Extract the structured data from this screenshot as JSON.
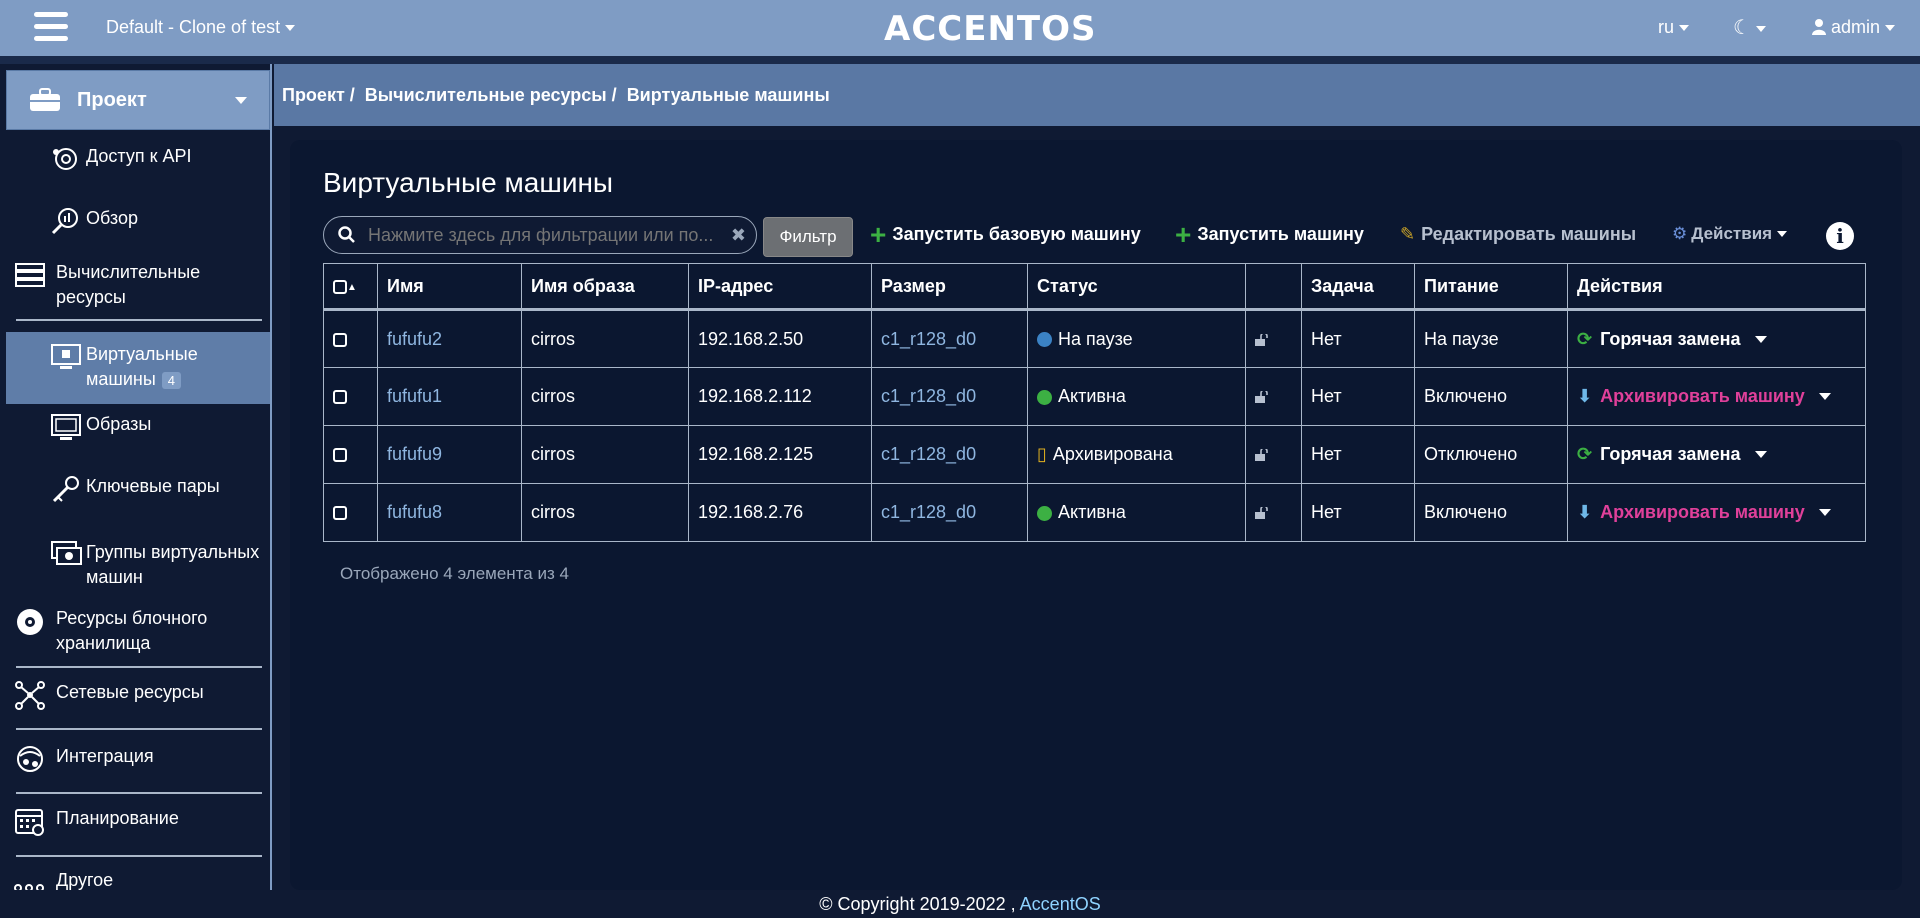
{
  "header": {
    "project_switch": "Default - Clone of test",
    "logo": "ACCENTOS",
    "lang": "ru",
    "user": "admin"
  },
  "sidebar": {
    "project_label": "Проект",
    "items": [
      {
        "label": "Доступ к API",
        "icon": "api-access-icon"
      },
      {
        "label": "Обзор",
        "icon": "overview-icon"
      },
      {
        "label": "Вычислительные ресурсы",
        "icon": "compute-icon"
      },
      {
        "label": "Виртуальные машины",
        "badge": "4",
        "icon": "vm-icon"
      },
      {
        "label": "Образы",
        "icon": "images-icon"
      },
      {
        "label": "Ключевые пары",
        "icon": "keypairs-icon"
      },
      {
        "label": "Группы виртуальных машин",
        "icon": "vm-groups-icon"
      },
      {
        "label": "Ресурсы блочного хранилища",
        "icon": "block-storage-icon"
      },
      {
        "label": "Сетевые ресурсы",
        "icon": "network-icon"
      },
      {
        "label": "Интеграция",
        "icon": "integration-icon"
      },
      {
        "label": "Планирование",
        "icon": "scheduling-icon"
      },
      {
        "label": "Другое",
        "icon": "other-icon"
      }
    ]
  },
  "breadcrumb": [
    "Проект /",
    "Вычислительные ресурсы /",
    "Виртуальные машины"
  ],
  "main": {
    "title": "Виртуальные машины",
    "search_placeholder": "Нажмите здесь для фильтрации или по...",
    "filter_button": "Фильтр",
    "launch_base": "Запустить базовую машину",
    "launch": "Запустить машину",
    "edit": "Редактировать машины",
    "actions": "Действия"
  },
  "table": {
    "columns": [
      "Имя",
      "Имя образа",
      "IP-адрес",
      "Размер",
      "Статус",
      "",
      "Задача",
      "Питание",
      "Действия"
    ],
    "rows": [
      {
        "name": "fufufu2",
        "image": "cirros",
        "ip": "192.168.2.50",
        "size": "c1_r128_d0",
        "status": "На паузе",
        "status_color": "#3b82c4",
        "task": "Нет",
        "power": "На паузе",
        "action": "Горячая замена",
        "action_kind": "hot"
      },
      {
        "name": "fufufu1",
        "image": "cirros",
        "ip": "192.168.2.112",
        "size": "c1_r128_d0",
        "status": "Активна",
        "status_color": "#3cb043",
        "task": "Нет",
        "power": "Включено",
        "action": "Архивировать машину",
        "action_kind": "archive"
      },
      {
        "name": "fufufu9",
        "image": "cirros",
        "ip": "192.168.2.125",
        "size": "c1_r128_d0",
        "status": "Архивирована",
        "status_color": "#e0b020",
        "task": "Нет",
        "power": "Отключено",
        "action": "Горячая замена",
        "action_kind": "hot"
      },
      {
        "name": "fufufu8",
        "image": "cirros",
        "ip": "192.168.2.76",
        "size": "c1_r128_d0",
        "status": "Активна",
        "status_color": "#3cb043",
        "task": "Нет",
        "power": "Включено",
        "action": "Архивировать машину",
        "action_kind": "archive"
      }
    ],
    "summary": "Отображено 4 элемента из 4"
  },
  "footer": {
    "copyright": "© Copyright 2019-2022 ,",
    "brand": "AccentOS"
  }
}
